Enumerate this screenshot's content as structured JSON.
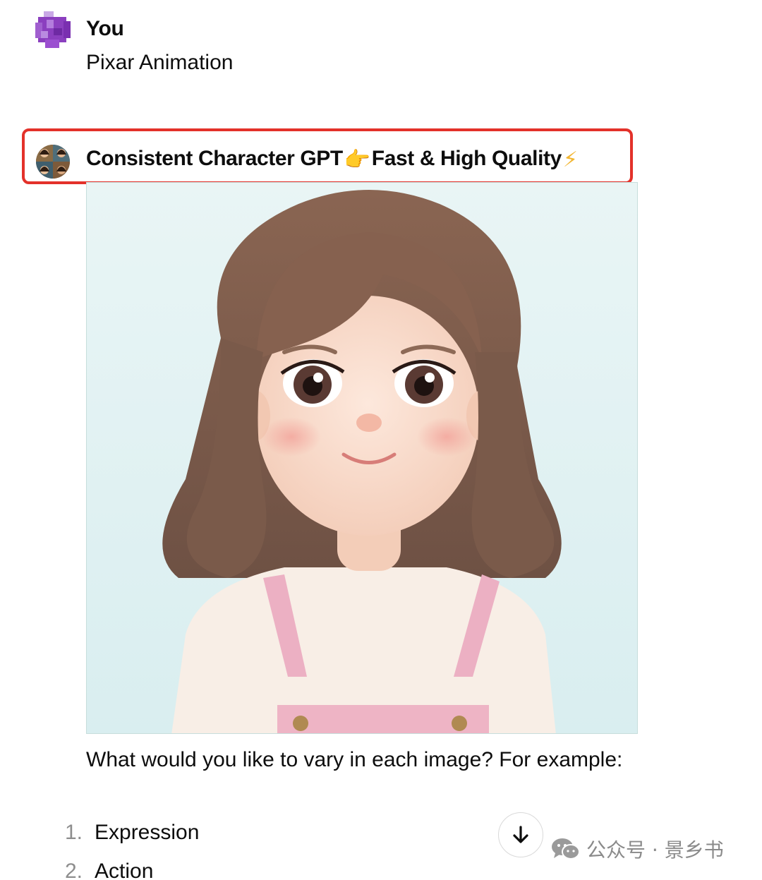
{
  "user": {
    "name": "You",
    "message": "Pixar Animation"
  },
  "assistant": {
    "name": "Consistent Character GPT",
    "name_mid_emoji": "👉",
    "name_suffix": "Fast & High Quality",
    "name_end_emoji": "⚡",
    "question": "What would you like to vary in each image? For example:",
    "options": [
      {
        "num": "1.",
        "label": "Expression"
      },
      {
        "num": "2.",
        "label": "Action"
      }
    ]
  },
  "icons": {
    "user_avatar": "pixel-avatar-icon",
    "gpt_avatar": "character-collage-avatar",
    "scroll": "arrow-down-icon",
    "watermark": "wechat-icon"
  },
  "colors": {
    "highlight": "#e3312a",
    "user_avatar": "#8b3fbf",
    "image_bg": "#e4f2f2"
  },
  "watermark": {
    "text": "公众号 · 景乡书"
  }
}
